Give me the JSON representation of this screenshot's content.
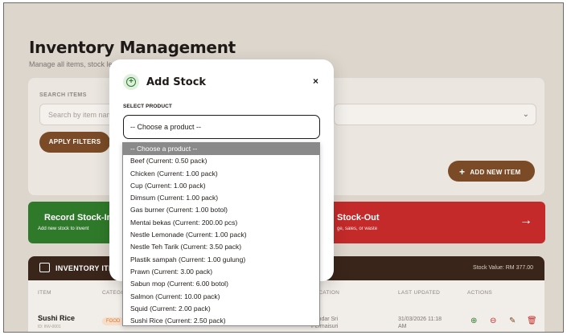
{
  "page": {
    "title": "Inventory Management",
    "subtitle": "Manage all items, stock le"
  },
  "filters": {
    "search_label": "SEARCH ITEMS",
    "search_placeholder": "Search by item nam",
    "apply_label": "APPLY FILTERS",
    "add_item_label": "ADD NEW ITEM"
  },
  "actions": {
    "stock_in_title": "Record Stock-In",
    "stock_in_sub": "Add new stock to invent",
    "stock_out_title": "Stock-Out",
    "stock_out_sub": "ge, sales, or waste"
  },
  "inventory": {
    "title": "INVENTORY ITE",
    "stock_value": "Stock Value: RM 377.00",
    "columns": [
      "ITEM",
      "CATEGO",
      "LOCATION",
      "LAST UPDATED",
      "ACTIONS"
    ],
    "row": {
      "name": "Sushi Rice",
      "id": "ID: INV-0001",
      "category": "FOOD",
      "location_line1": "Bandar Sri",
      "location_line2": "Permaisuri",
      "updated_line1": "31/03/2026 11:18",
      "updated_line2": "AM"
    }
  },
  "modal": {
    "title": "Add Stock",
    "close_glyph": "×",
    "select_label": "SELECT PRODUCT",
    "select_value": "-- Choose a product --"
  },
  "dropdown": {
    "options": [
      "-- Choose a product --",
      "Beef (Current: 0.50 pack)",
      "Chicken (Current: 1.00 pack)",
      "Cup (Current: 1.00 pack)",
      "Dimsum (Current: 1.00 pack)",
      "Gas burner (Current: 1.00 botol)",
      "Mentai bekas (Current: 200.00 pcs)",
      "Nestle Lemonade (Current: 1.00 pack)",
      "Nestle Teh Tarik (Current: 3.50 pack)",
      "Plastik sampah (Current: 1.00 gulung)",
      "Prawn (Current: 3.00 pack)",
      "Sabun mop (Current: 6.00 botol)",
      "Salmon (Current: 10.00 pack)",
      "Squid (Current: 2.00 pack)",
      "Sushi Rice (Current: 2.50 pack)"
    ],
    "selected_index": 0
  },
  "colors": {
    "brown": "#7a4b26",
    "green": "#2f7a2a",
    "red": "#c42a2a",
    "header_dark": "#3a251a"
  }
}
